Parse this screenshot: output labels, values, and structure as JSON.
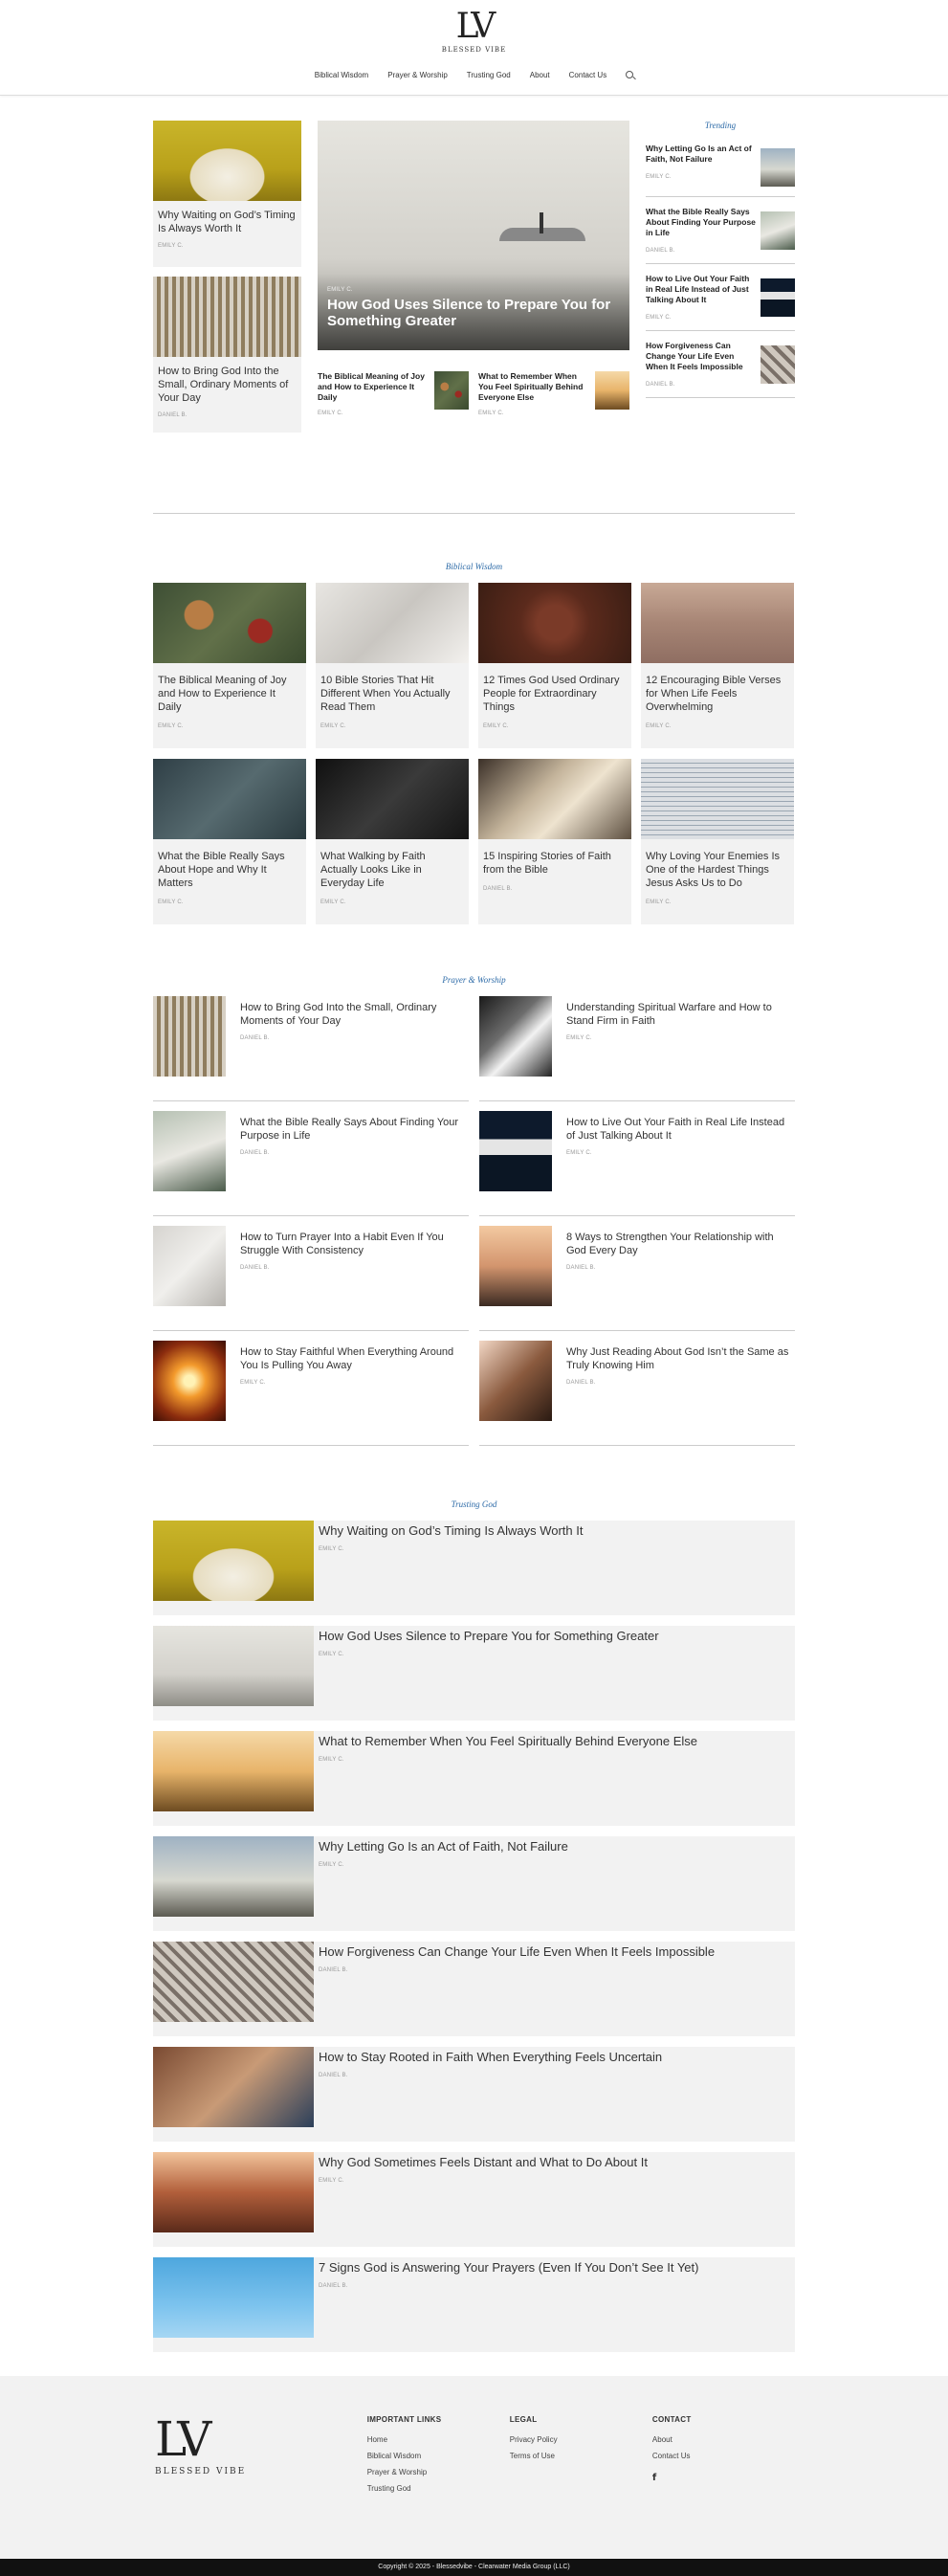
{
  "brand": {
    "mark": "LV",
    "name": "BLESSED VIBE"
  },
  "nav": [
    "Biblical Wisdom",
    "Prayer & Worship",
    "Trusting God",
    "About",
    "Contact Us"
  ],
  "hero": {
    "left": [
      {
        "title": "Why Waiting on God’s Timing Is Always Worth It",
        "author": "EMILY C."
      },
      {
        "title": "How to Bring God Into the Small, Ordinary Moments of Your Day",
        "author": "DANIEL B."
      }
    ],
    "main": {
      "title": "How God Uses Silence to Prepare You for Something Greater",
      "author": "EMILY C."
    },
    "subs": [
      {
        "title": "The Biblical Meaning of Joy and How to Experience It Daily",
        "author": "EMILY C."
      },
      {
        "title": "What to Remember When You Feel Spiritually Behind Everyone Else",
        "author": "EMILY C."
      }
    ],
    "trending_title": "Trending",
    "trending": [
      {
        "title": "Why Letting Go Is an Act of Faith, Not Failure",
        "author": "EMILY C."
      },
      {
        "title": "What the Bible Really Says About Finding Your Purpose in Life",
        "author": "DANIEL B."
      },
      {
        "title": "How to Live Out Your Faith in Real Life Instead of Just Talking About It",
        "author": "EMILY C."
      },
      {
        "title": "How Forgiveness Can Change Your Life Even When It Feels Impossible",
        "author": "DANIEL B."
      }
    ]
  },
  "biblical_wisdom": {
    "title": "Biblical Wisdom",
    "items": [
      {
        "title": "The Biblical Meaning of Joy and How to Experience It Daily",
        "author": "EMILY C."
      },
      {
        "title": "10 Bible Stories That Hit Different When You Actually Read Them",
        "author": "EMILY C."
      },
      {
        "title": "12 Times God Used Ordinary People for Extraordinary Things",
        "author": "EMILY C."
      },
      {
        "title": "12 Encouraging Bible Verses for When Life Feels Overwhelming",
        "author": "EMILY C."
      },
      {
        "title": "What the Bible Really Says About Hope and Why It Matters",
        "author": "EMILY C."
      },
      {
        "title": "What Walking by Faith Actually Looks Like in Everyday Life",
        "author": "EMILY C."
      },
      {
        "title": "15 Inspiring Stories of Faith from the Bible",
        "author": "DANIEL B."
      },
      {
        "title": "Why Loving Your Enemies Is One of the Hardest Things Jesus Asks Us to Do",
        "author": "EMILY C."
      }
    ]
  },
  "prayer_worship": {
    "title": "Prayer & Worship",
    "items": [
      {
        "title": "How to Bring God Into the Small, Ordinary Moments of Your Day",
        "author": "DANIEL B."
      },
      {
        "title": "Understanding Spiritual Warfare and How to Stand Firm in Faith",
        "author": "EMILY C."
      },
      {
        "title": "What the Bible Really Says About Finding Your Purpose in Life",
        "author": "DANIEL B."
      },
      {
        "title": "How to Live Out Your Faith in Real Life Instead of Just Talking About It",
        "author": "EMILY C."
      },
      {
        "title": "How to Turn Prayer Into a Habit Even If You Struggle With Consistency",
        "author": "DANIEL B."
      },
      {
        "title": "8 Ways to Strengthen Your Relationship with God Every Day",
        "author": "DANIEL B."
      },
      {
        "title": "How to Stay Faithful When Everything Around You Is Pulling You Away",
        "author": "EMILY C."
      },
      {
        "title": "Why Just Reading About God Isn’t the Same as Truly Knowing Him",
        "author": "DANIEL B."
      }
    ]
  },
  "trusting_god": {
    "title": "Trusting God",
    "items": [
      {
        "title": "Why Waiting on God’s Timing Is Always Worth It",
        "author": "EMILY C."
      },
      {
        "title": "How God Uses Silence to Prepare You for Something Greater",
        "author": "EMILY C."
      },
      {
        "title": "What to Remember When You Feel Spiritually Behind Everyone Else",
        "author": "EMILY C."
      },
      {
        "title": "Why Letting Go Is an Act of Faith, Not Failure",
        "author": "EMILY C."
      },
      {
        "title": "How Forgiveness Can Change Your Life Even When It Feels Impossible",
        "author": "DANIEL B."
      },
      {
        "title": "How to Stay Rooted in Faith When Everything Feels Uncertain",
        "author": "DANIEL B."
      },
      {
        "title": "Why God Sometimes Feels Distant and What to Do About It",
        "author": "EMILY C."
      },
      {
        "title": "7 Signs God is Answering Your Prayers (Even If You Don’t See It Yet)",
        "author": "DANIEL B."
      }
    ]
  },
  "footer": {
    "important_title": "IMPORTANT LINKS",
    "important_links": [
      "Home",
      "Biblical Wisdom",
      "Prayer & Worship",
      "Trusting God"
    ],
    "legal_title": "LEGAL",
    "legal_links": [
      "Privacy Policy",
      "Terms of Use"
    ],
    "contact_title": "CONTACT",
    "contact_links": [
      "About",
      "Contact Us"
    ],
    "social_icon": "facebook-icon",
    "copyright": "Copyright © 2025 - Blessedvibe - Clearwater Media Group (LLC)"
  },
  "colors": {
    "accent": "#2c6aa7",
    "card_bg": "#f2f2f2",
    "footer_bg": "#f2f2f2",
    "bottom_bar": "#111111"
  }
}
